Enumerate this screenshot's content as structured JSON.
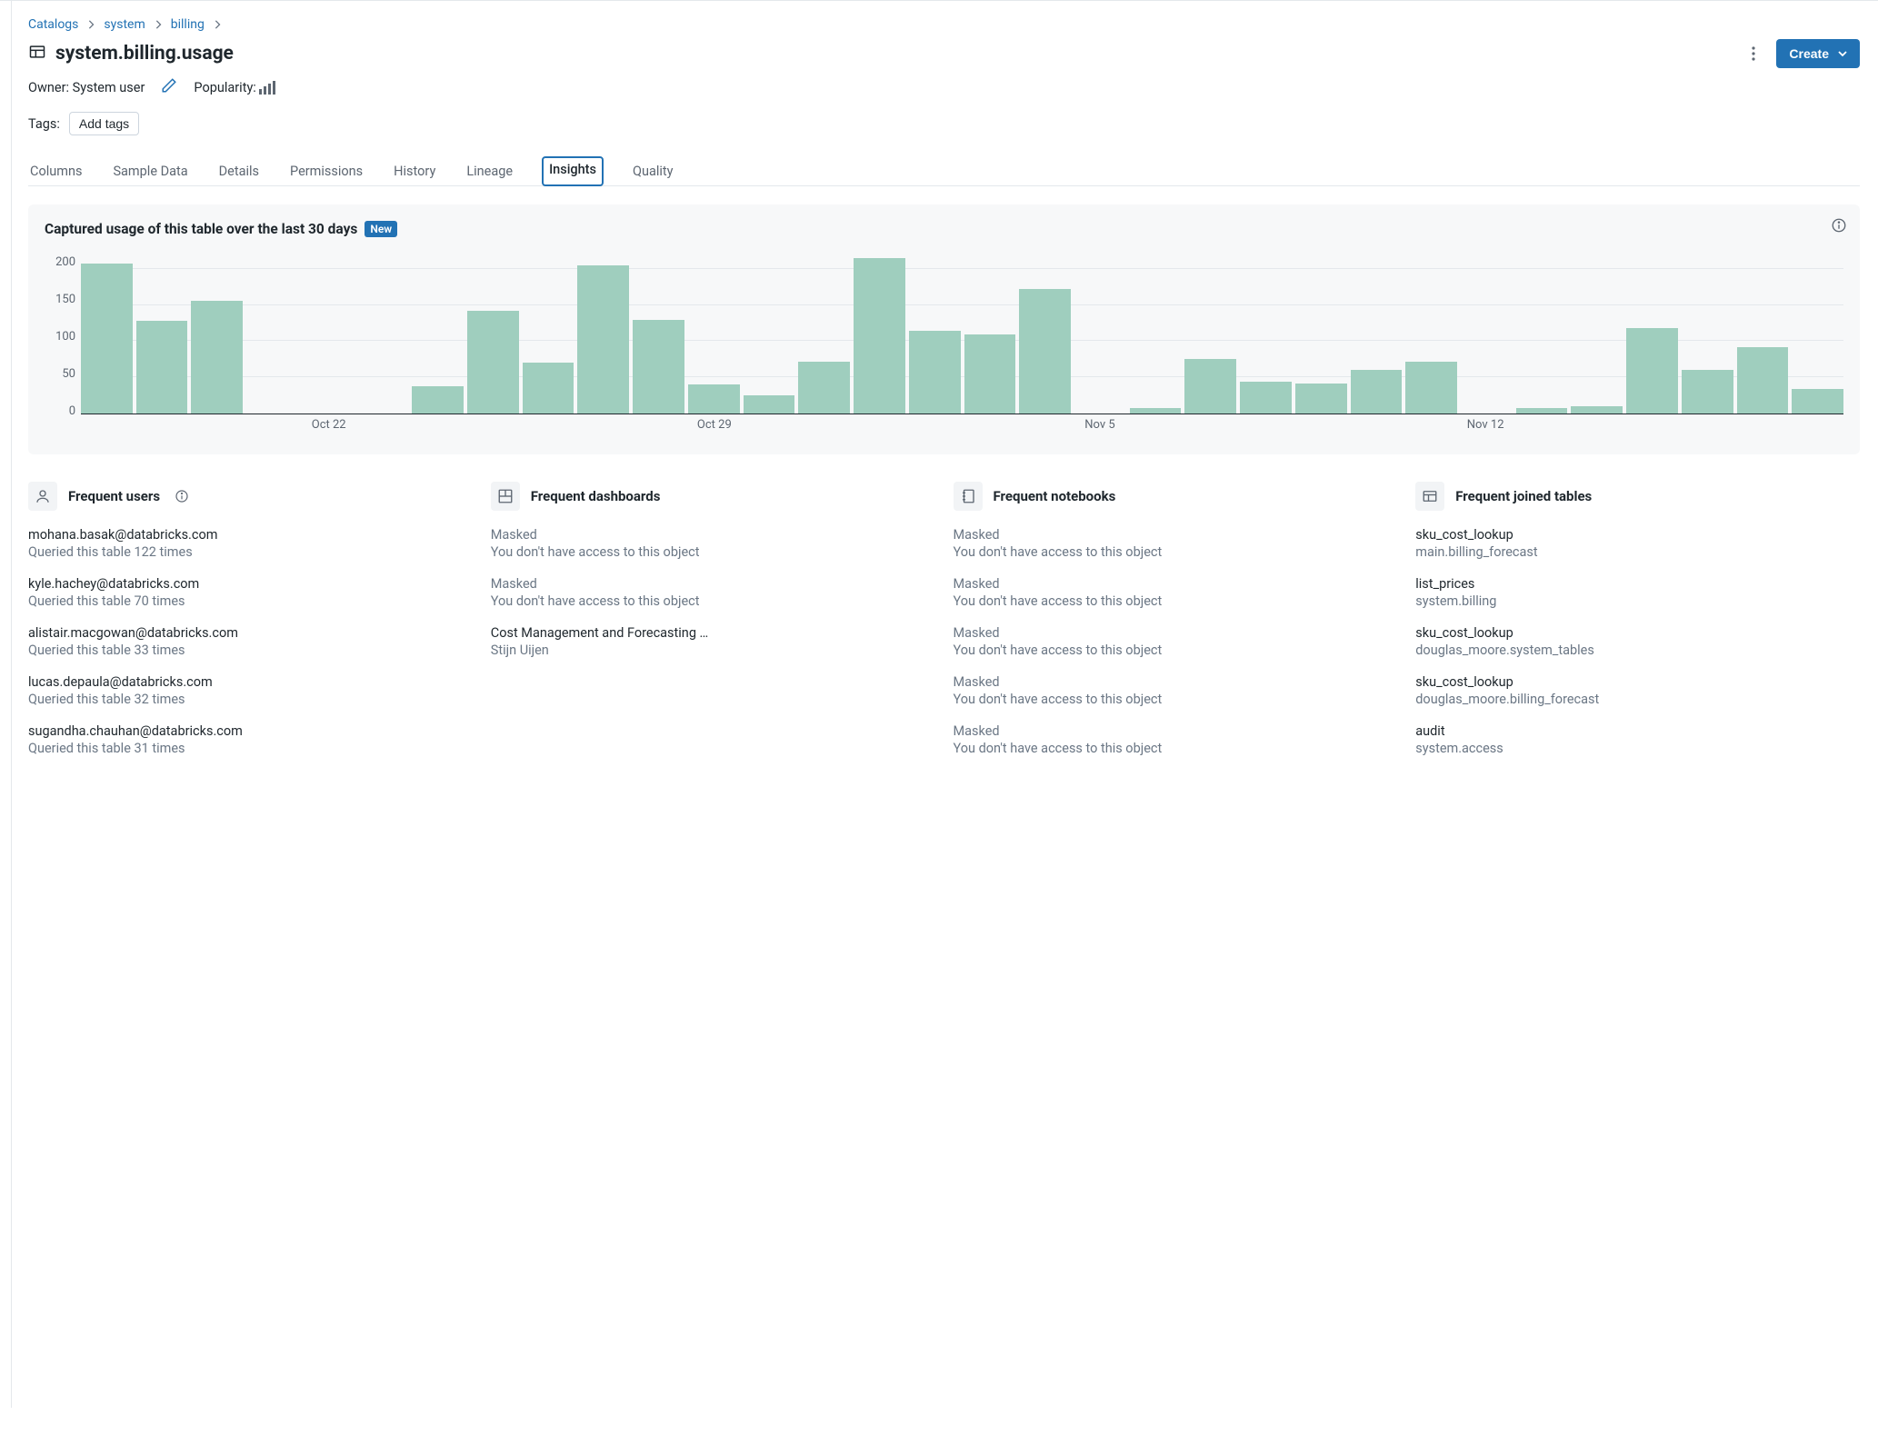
{
  "breadcrumb": {
    "items": [
      "Catalogs",
      "system",
      "billing"
    ]
  },
  "page_title": "system.billing.usage",
  "owner": {
    "label": "Owner:",
    "value": "System user"
  },
  "popularity_label": "Popularity:",
  "tags": {
    "label": "Tags:",
    "button": "Add tags"
  },
  "create_button": "Create",
  "tabs": [
    "Columns",
    "Sample Data",
    "Details",
    "Permissions",
    "History",
    "Lineage",
    "Insights",
    "Quality"
  ],
  "active_tab": "Insights",
  "panel": {
    "title": "Captured usage of this table over the last 30 days",
    "badge": "New"
  },
  "chart_data": {
    "type": "bar",
    "title": "Captured usage of this table over the last 30 days",
    "xlabel": "",
    "ylabel": "",
    "ylim": [
      0,
      220
    ],
    "y_ticks": [
      0,
      50,
      100,
      150,
      200
    ],
    "categories": [
      "Oct 18",
      "Oct 19",
      "Oct 20",
      "Oct 21",
      "Oct 22",
      "Oct 23",
      "Oct 24",
      "Oct 25",
      "Oct 26",
      "Oct 27",
      "Oct 28",
      "Oct 29",
      "Oct 30",
      "Oct 31",
      "Nov 1",
      "Nov 2",
      "Nov 3",
      "Nov 4",
      "Nov 5",
      "Nov 6",
      "Nov 7",
      "Nov 8",
      "Nov 9",
      "Nov 10",
      "Nov 11",
      "Nov 12",
      "Nov 13",
      "Nov 14",
      "Nov 15",
      "Nov 16",
      "Nov 17"
    ],
    "values": [
      208,
      128,
      156,
      0,
      0,
      0,
      38,
      142,
      70,
      205,
      130,
      40,
      25,
      72,
      215,
      115,
      110,
      172,
      0,
      8,
      76,
      44,
      42,
      60,
      72,
      0,
      8,
      10,
      118,
      60,
      92,
      34
    ],
    "x_ticks": {
      "4": "Oct 22",
      "11": "Oct 29",
      "18": "Nov 5",
      "25": "Nov 12"
    }
  },
  "freq_headers": {
    "users": "Frequent users",
    "dashboards": "Frequent dashboards",
    "notebooks": "Frequent notebooks",
    "tables": "Frequent joined tables"
  },
  "freq_users": [
    {
      "name": "mohana.basak@databricks.com",
      "sub": "Queried this table 122 times"
    },
    {
      "name": "kyle.hachey@databricks.com",
      "sub": "Queried this table 70 times"
    },
    {
      "name": "alistair.macgowan@databricks.com",
      "sub": "Queried this table 33 times"
    },
    {
      "name": "lucas.depaula@databricks.com",
      "sub": "Queried this table 32 times"
    },
    {
      "name": "sugandha.chauhan@databricks.com",
      "sub": "Queried this table 31 times"
    }
  ],
  "freq_dashboards": [
    {
      "name": "Masked",
      "sub": "You don't have access to this object",
      "masked": true
    },
    {
      "name": "Masked",
      "sub": "You don't have access to this object",
      "masked": true
    },
    {
      "name": "Cost Management and Forecasting …",
      "sub": "Stijn Uijen",
      "masked": false
    }
  ],
  "freq_notebooks": [
    {
      "name": "Masked",
      "sub": "You don't have access to this object",
      "masked": true
    },
    {
      "name": "Masked",
      "sub": "You don't have access to this object",
      "masked": true
    },
    {
      "name": "Masked",
      "sub": "You don't have access to this object",
      "masked": true
    },
    {
      "name": "Masked",
      "sub": "You don't have access to this object",
      "masked": true
    },
    {
      "name": "Masked",
      "sub": "You don't have access to this object",
      "masked": true
    }
  ],
  "freq_tables": [
    {
      "name": "sku_cost_lookup",
      "sub": "main.billing_forecast"
    },
    {
      "name": "list_prices",
      "sub": "system.billing"
    },
    {
      "name": "sku_cost_lookup",
      "sub": "douglas_moore.system_tables"
    },
    {
      "name": "sku_cost_lookup",
      "sub": "douglas_moore.billing_forecast"
    },
    {
      "name": "audit",
      "sub": "system.access"
    }
  ]
}
